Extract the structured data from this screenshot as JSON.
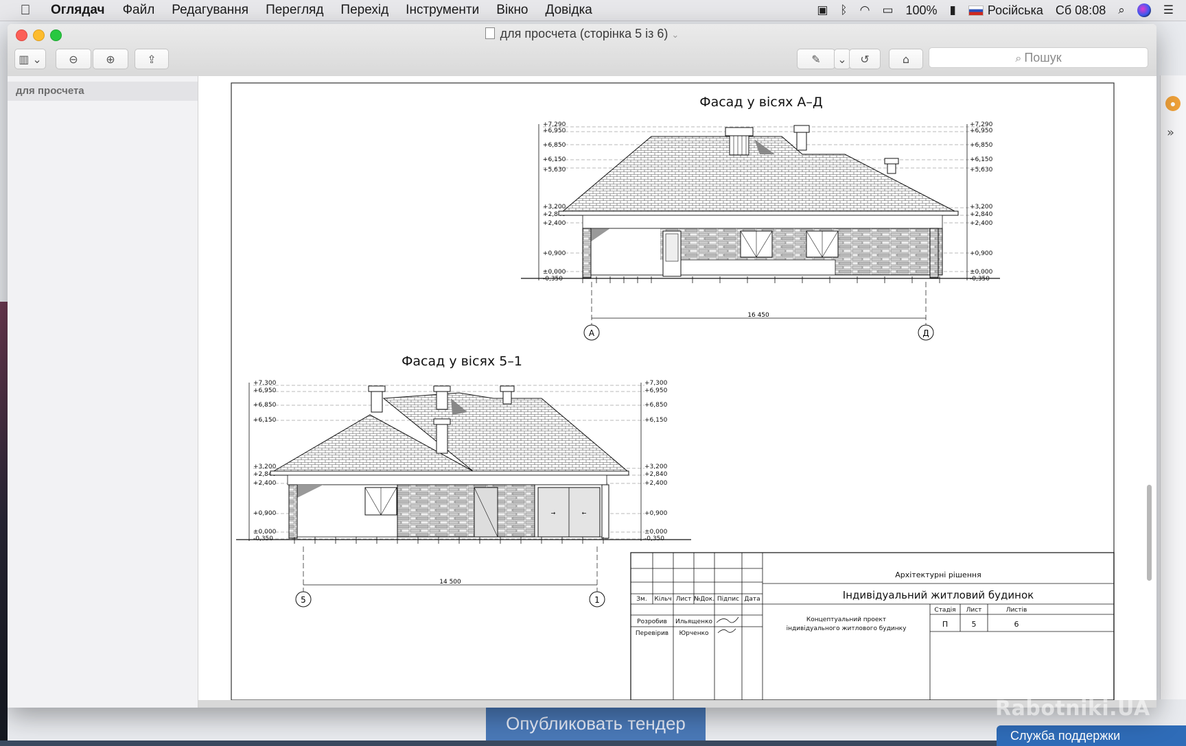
{
  "menubar": {
    "app_name": "Оглядач",
    "items": [
      "Файл",
      "Редагування",
      "Перегляд",
      "Перехід",
      "Інструменти",
      "Вікно",
      "Довідка"
    ],
    "battery": "100%",
    "input_source": "Російська",
    "clock": "Сб 08:08"
  },
  "window": {
    "title": "для просчета (сторінка 5 із 6)",
    "search_placeholder": "Пошук",
    "sidebar_item": "для просчета"
  },
  "drawing": {
    "facade_top_title": "Фасад у вісях А–Д",
    "facade_bottom_title": "Фасад у вісях 5–1",
    "top_left_levels": [
      "+7,290",
      "+6,950",
      "+6,850",
      "+6,150",
      "+5,630",
      "+3,200",
      "+2,840",
      "+2,400",
      "+0,900",
      "±0,000",
      "-0,350"
    ],
    "top_right_levels": [
      "+7,290",
      "+6,950",
      "+6,850",
      "+6,150",
      "+5,630",
      "+3,200",
      "+2,840",
      "+2,400",
      "+0,900",
      "±0,000",
      "-0,350"
    ],
    "bottom_left_levels": [
      "+7,300",
      "+6,950",
      "+6,850",
      "+6,150",
      "+3,200",
      "+2,840",
      "+2,400",
      "+0,900",
      "±0,000",
      "-0,350"
    ],
    "bottom_right_levels": [
      "+7,300",
      "+6,950",
      "+6,850",
      "+6,150",
      "+3,200",
      "+2,840",
      "+2,400",
      "+0,900",
      "±0,000",
      "-0,350"
    ],
    "top_dimension": "16 450",
    "bottom_dimension": "14 500",
    "axis_a": "А",
    "axis_d": "Д",
    "axis_5": "5",
    "axis_1": "1"
  },
  "title_block": {
    "section": "Архітектурні рішення",
    "building": "Індивідуальний житловий будинок",
    "project_line1": "Концептуальний проект",
    "project_line2": "індивідуального житлового будинку",
    "headers": [
      "Зм.",
      "Кільч",
      "Лист",
      "№Док.",
      "Підпис",
      "Дата"
    ],
    "developed_label": "Розробив",
    "developed_name": "Ильященко",
    "checked_label": "Перевірив",
    "checked_name": "Юрченко",
    "stage_label": "Стадія",
    "sheet_label": "Лист",
    "sheets_label": "Листів",
    "stage": "П",
    "sheet": "5",
    "sheets": "6"
  },
  "background": {
    "publish_button": "Опубликовать тендер",
    "support_button": "Служба поддержки",
    "watermark": "Rabotniki.UA"
  },
  "colors": {
    "accent_blue": "#4a79b8",
    "traffic_red": "#fc5f57",
    "traffic_yellow": "#fdbc2e",
    "traffic_green": "#28c840"
  }
}
